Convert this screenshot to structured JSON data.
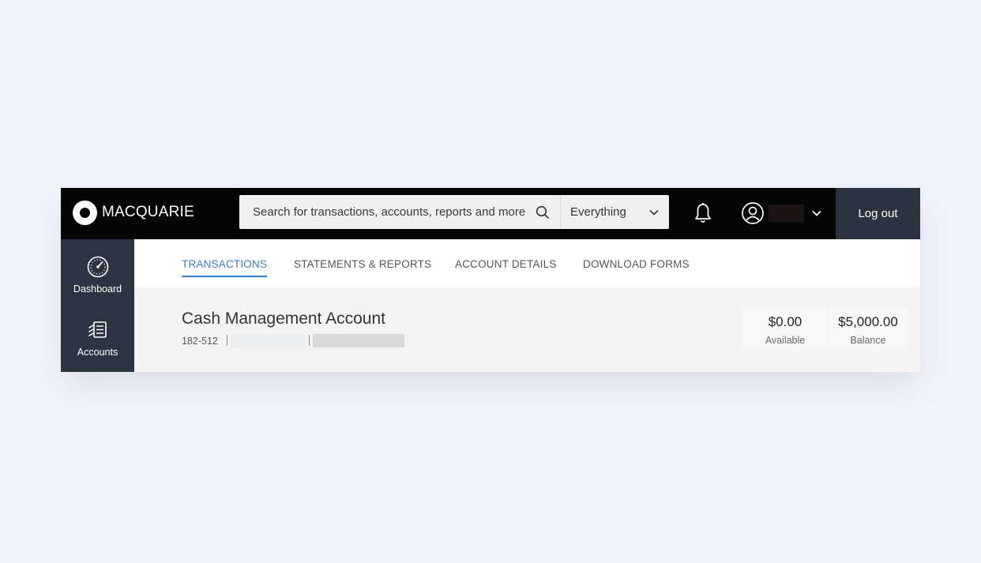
{
  "header": {
    "logo_text": "MACQUARIE",
    "search": {
      "placeholder": "Search for transactions, accounts, reports and more",
      "scope": "Everything"
    },
    "logout_label": "Log out"
  },
  "sidebar": {
    "items": [
      {
        "label": "Dashboard",
        "icon": "dashboard-gauge-icon"
      },
      {
        "label": "Accounts",
        "icon": "accounts-cash-icon"
      }
    ]
  },
  "tabs": [
    {
      "label": "TRANSACTIONS",
      "active": true
    },
    {
      "label": "STATEMENTS & REPORTS",
      "active": false
    },
    {
      "label": "ACCOUNT DETAILS",
      "active": false
    },
    {
      "label": "DOWNLOAD FORMS",
      "active": false
    }
  ],
  "account": {
    "name": "Cash Management Account",
    "bsb": "182-512",
    "available_value": "$0.00",
    "available_label": "Available",
    "balance_value": "$5,000.00",
    "balance_label": "Balance"
  },
  "colors": {
    "topbar": "#050505",
    "sidebar": "#2d3441",
    "logout": "#2c3340",
    "accent": "#3b7ec7",
    "page_background": "#f2f5fc"
  }
}
